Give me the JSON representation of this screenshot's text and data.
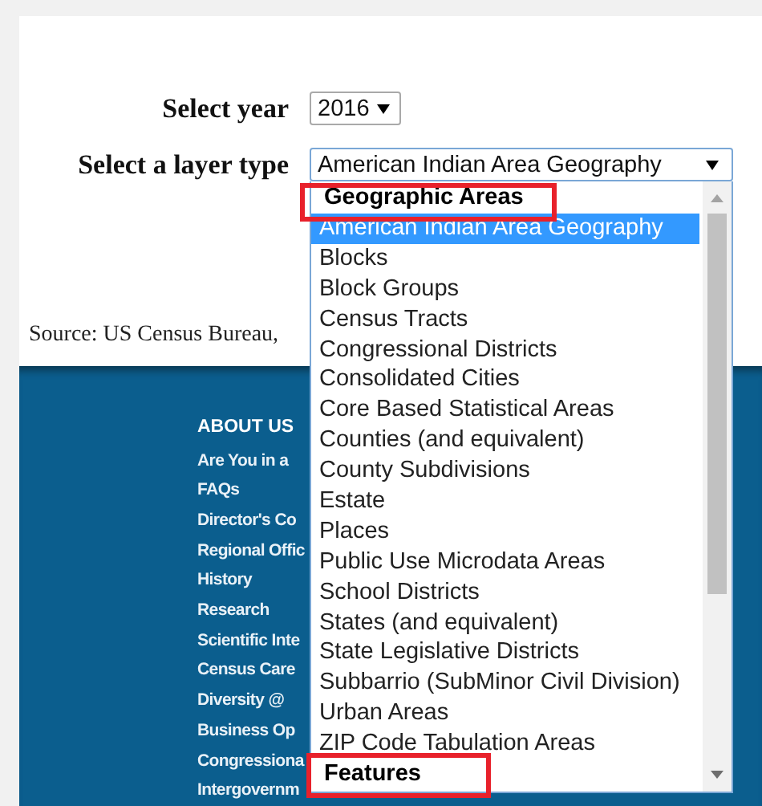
{
  "form": {
    "year_label": "Select year",
    "year_value": "2016",
    "layer_label": "Select a layer type",
    "layer_value": "American Indian Area Geography"
  },
  "source": "Source: US Census Bureau,",
  "dropdown": {
    "groups": [
      {
        "label": "Geographic Areas",
        "highlighted": true,
        "options": [
          {
            "label": "American Indian Area Geography",
            "selected": true
          },
          {
            "label": "Blocks",
            "selected": false
          },
          {
            "label": "Block Groups",
            "selected": false
          },
          {
            "label": "Census Tracts",
            "selected": false
          },
          {
            "label": "Congressional Districts",
            "selected": false
          },
          {
            "label": "Consolidated Cities",
            "selected": false
          },
          {
            "label": "Core Based Statistical Areas",
            "selected": false
          },
          {
            "label": "Counties (and equivalent)",
            "selected": false
          },
          {
            "label": "County Subdivisions",
            "selected": false
          },
          {
            "label": "Estate",
            "selected": false
          },
          {
            "label": "Places",
            "selected": false
          },
          {
            "label": "Public Use Microdata Areas",
            "selected": false
          },
          {
            "label": "School Districts",
            "selected": false
          },
          {
            "label": "States (and equivalent)",
            "selected": false
          },
          {
            "label": "State Legislative Districts",
            "selected": false
          },
          {
            "label": "Subbarrio (SubMinor Civil Division)",
            "selected": false
          },
          {
            "label": "Urban Areas",
            "selected": false
          },
          {
            "label": "ZIP Code Tabulation Areas",
            "selected": false
          }
        ]
      },
      {
        "label": "Features",
        "highlighted": true
      }
    ]
  },
  "footer": {
    "heading": "ABOUT US",
    "links": [
      "Are You in a",
      "FAQs",
      "Director's Co",
      "Regional Offic",
      "History",
      "Research",
      "Scientific Inte",
      "Census Care",
      "Diversity @",
      "Business Op",
      "Congressiona",
      "Intergovernm"
    ]
  }
}
